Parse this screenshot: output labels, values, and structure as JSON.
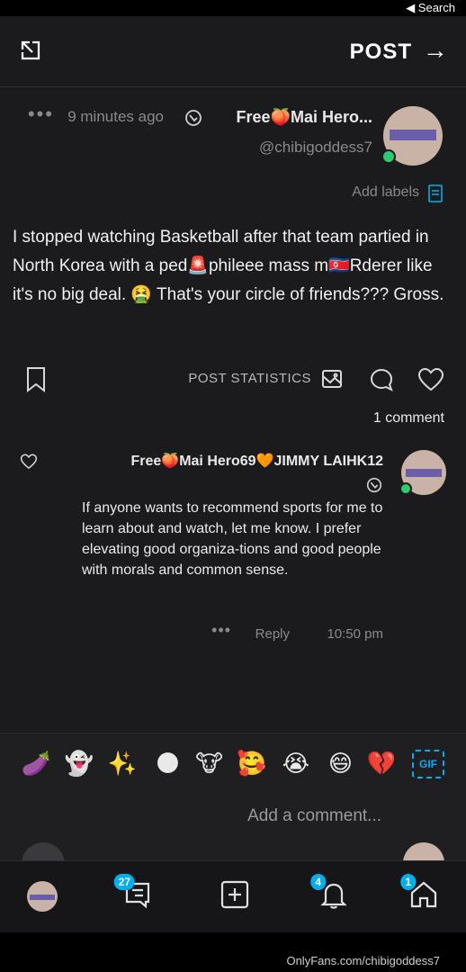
{
  "status_bar": {
    "back_label": "◀ Search"
  },
  "header": {
    "title": "POST"
  },
  "post": {
    "author_name": "Free🍑Mai Hero...",
    "username": "@chibigoddess7",
    "time": "9 minutes ago",
    "add_labels": "Add labels",
    "body": "I stopped watching Basketball after that team partied in North Korea with a ped🚨phileee mass m🇰🇵Rderer like it's no big deal. 🤮 That's your circle of friends??? Gross.",
    "post_statistics": "POST STATISTICS",
    "comment_count": "1 comment"
  },
  "comment": {
    "author_name": "Free🍑Mai Hero69🧡JIMMY LAIHK12",
    "body": "If anyone wants to recommend sports for me to learn about and watch, let me know. I prefer elevating good organiza-tions and good people with morals and common sense.",
    "time": "10:50 pm",
    "reply_label": "Reply"
  },
  "emoji_bar": {
    "gif_label": "GIF",
    "emojis": [
      "💔",
      "😅",
      "😭",
      "🥰",
      "🐮",
      "🌑",
      "✨",
      "👻",
      "🍆"
    ]
  },
  "comment_input": {
    "placeholder": "Add a comment..."
  },
  "tab_bar": {
    "home_badge": "1",
    "notifications_badge": "4",
    "messages_badge": "27"
  },
  "footer": {
    "watermark": "OnlyFans.com/chibigoddess7"
  },
  "colors": {
    "accent": "#00aff0",
    "online": "#2dcc70",
    "background": "#1b1b1d"
  }
}
